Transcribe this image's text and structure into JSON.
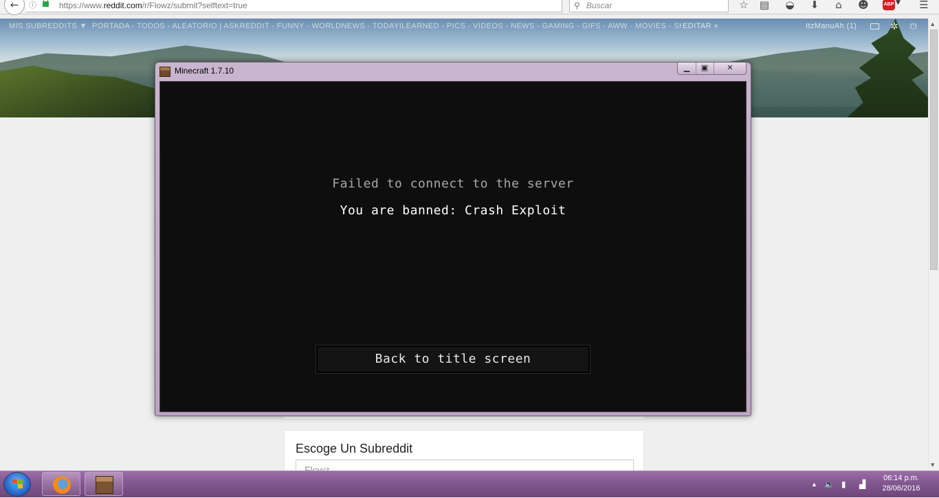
{
  "browser": {
    "url_prefix": "https://www.",
    "url_domain": "reddit.com",
    "url_path": "/r/Flowz/submit?selftext=true",
    "search_placeholder": "Buscar",
    "abp_label": "ABP"
  },
  "reddit": {
    "my_subreddits": "MIS SUBREDDITS ▼",
    "nav_links": "PORTADA - TODOS - ALEATORIO  |  ASKREDDIT - FUNNY - WORLDNEWS - TODAYILEARNED - PICS - VIDEOS - NEWS - GAMING - GIFS - AWW - MOVIES - SHOWERTHOUGHTS",
    "edit_link": "EDITAR »",
    "username": "ItzManuAh",
    "karma": "(1)",
    "card_heading": "Escoge Un Subreddit",
    "subreddit_value": "Flowz"
  },
  "minecraft": {
    "window_title": "Minecraft 1.7.10",
    "message_title": "Failed to connect to the server",
    "message_reason": "You are banned: Crash Exploit",
    "back_button": "Back to title screen"
  },
  "taskbar": {
    "time": "06:14 p.m.",
    "date": "28/06/2016"
  }
}
